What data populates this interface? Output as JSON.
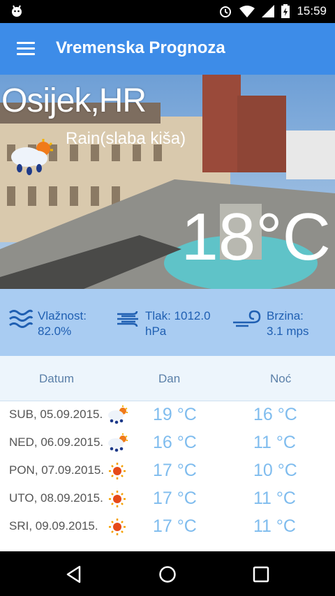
{
  "status_bar": {
    "time": "15:59",
    "icons": [
      "android-icon",
      "alarm-icon",
      "wifi-icon",
      "signal-icon",
      "battery-charging-icon"
    ]
  },
  "app_bar": {
    "title": "Vremenska Prognoza",
    "menu_icon": "menu-icon"
  },
  "current": {
    "city": "Osijek,HR",
    "description": "Rain(slaba kiša)",
    "temperature": "18°C",
    "icon": "rain-cloud-sun-icon"
  },
  "stats": [
    {
      "label": "Vlažnost:",
      "value": "82.0%",
      "icon": "waves-icon"
    },
    {
      "label": "Tlak: 1012.0",
      "value": "hPa",
      "icon": "wind-icon"
    },
    {
      "label": "Brzina:",
      "value": "3.1 mps",
      "icon": "wind-swirl-icon"
    }
  ],
  "table": {
    "headers": {
      "date": "Datum",
      "day": "Dan",
      "night": "Noć"
    },
    "rows": [
      {
        "date": "SUB, 05.09.2015.",
        "day": "19 °C",
        "night": "16 °C",
        "icon": "rain-cloud-sun-icon"
      },
      {
        "date": "NED, 06.09.2015.",
        "day": "16 °C",
        "night": "11 °C",
        "icon": "rain-cloud-sun-icon"
      },
      {
        "date": "PON, 07.09.2015.",
        "day": "17 °C",
        "night": "10 °C",
        "icon": "sun-icon"
      },
      {
        "date": "UTO, 08.09.2015.",
        "day": "17 °C",
        "night": "11 °C",
        "icon": "sun-icon"
      },
      {
        "date": "SRI, 09.09.2015.",
        "day": "17 °C",
        "night": "11 °C",
        "icon": "sun-icon"
      }
    ]
  },
  "nav_bar": {
    "icons": [
      "back-icon",
      "home-icon",
      "recents-icon"
    ]
  },
  "colors": {
    "app_bar": "#3d8ce8",
    "stats_bg": "#a9ccf2",
    "temp_text": "#7fbcee",
    "stats_text": "#1f5fb2"
  }
}
